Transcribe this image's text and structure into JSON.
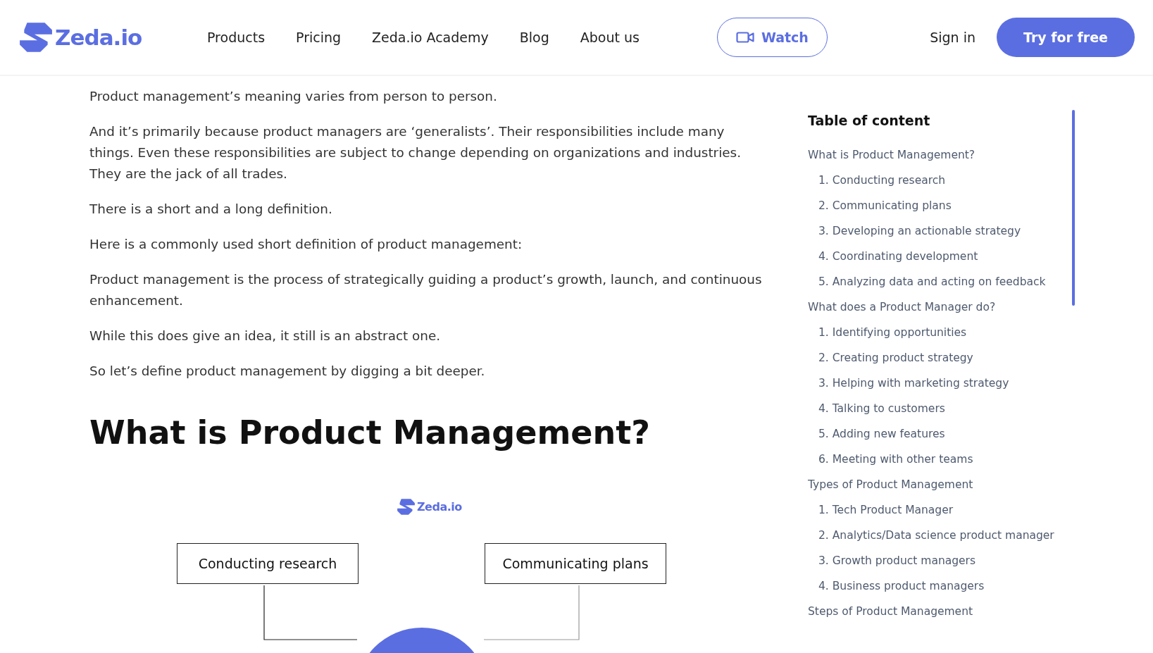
{
  "header": {
    "logo": "Zeda.io",
    "nav": [
      {
        "label": "Products"
      },
      {
        "label": "Pricing"
      },
      {
        "label": "Zeda.io Academy"
      },
      {
        "label": "Blog"
      },
      {
        "label": "About us"
      }
    ],
    "watch_button": "Watch",
    "sign_in": "Sign in",
    "cta": "Try for free"
  },
  "article": {
    "paragraphs": [
      "Product management’s meaning varies from person to person.",
      "And it’s primarily because product managers are ‘generalists’. Their responsibilities include many things. Even these responsibilities are subject to change depending on organizations and industries. They are the jack of all trades.",
      "There is a short and a long definition.",
      "Here is a commonly used short definition of product management:",
      "Product management is the process of strategically guiding a product’s growth, launch, and continuous enhancement.",
      "While this does give an idea, it still is an abstract one.",
      "So let’s define product management by digging a bit deeper."
    ],
    "heading": "What is Product Management?",
    "diagram": {
      "logo": "Zeda.io",
      "nodes": [
        "Conducting research",
        "Communicating plans"
      ]
    }
  },
  "toc": {
    "title": "Table of content",
    "items": [
      {
        "label": "What is Product Management?",
        "children": [
          {
            "label": "1. Conducting research"
          },
          {
            "label": "2. Communicating plans"
          },
          {
            "label": "3. Developing an actionable strategy"
          },
          {
            "label": "4. Coordinating development"
          },
          {
            "label": "5. Analyzing data and acting on feedback"
          }
        ]
      },
      {
        "label": "What does a Product Manager do?",
        "children": [
          {
            "label": "1. Identifying opportunities"
          },
          {
            "label": "2. Creating product strategy"
          },
          {
            "label": "3. Helping with marketing strategy"
          },
          {
            "label": "4. Talking to customers"
          },
          {
            "label": "5. Adding new features"
          },
          {
            "label": "6. Meeting with other teams"
          }
        ]
      },
      {
        "label": "Types of Product Management",
        "children": [
          {
            "label": "1. Tech Product Manager"
          },
          {
            "label": "2. Analytics/Data science product manager"
          },
          {
            "label": "3. Growth product managers"
          },
          {
            "label": "4. Business product managers"
          }
        ]
      },
      {
        "label": "Steps of Product Management"
      }
    ]
  }
}
